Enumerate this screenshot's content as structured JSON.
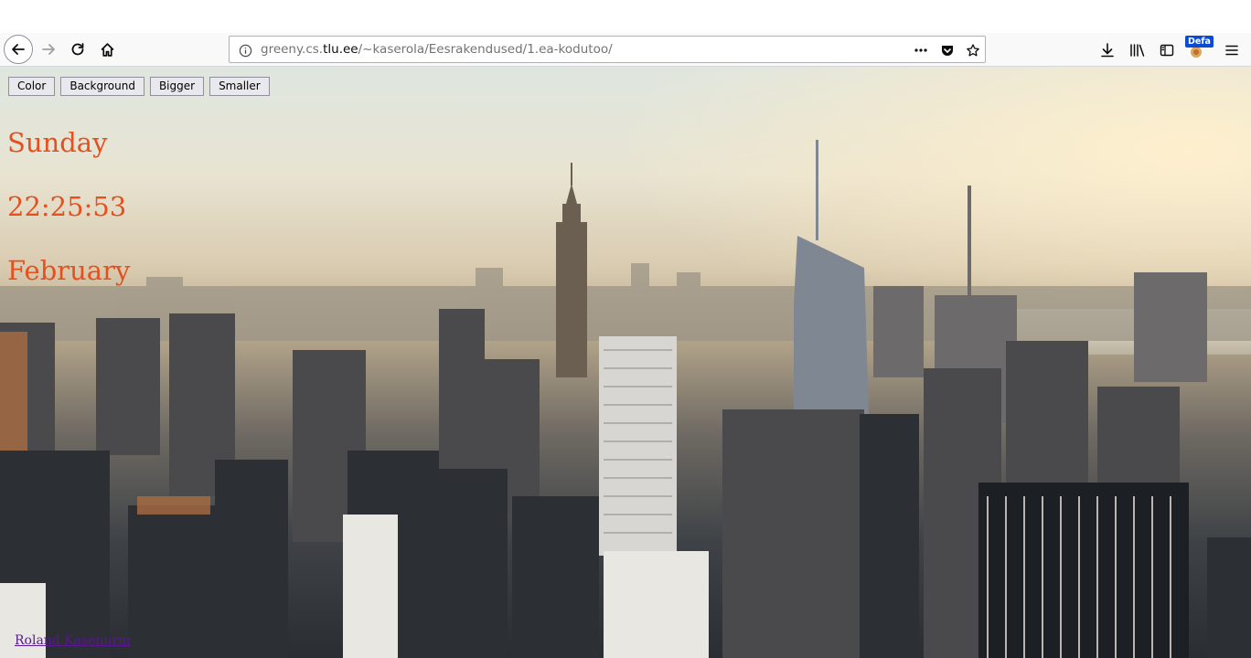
{
  "browser": {
    "url": {
      "prefix": "greeny.cs.",
      "domain": "tlu.ee",
      "path": "/~kaserola/Eesrakendused/1.ea-kodutoo/"
    },
    "badge_label": "Defa",
    "icons": {
      "back": "back-arrow-icon",
      "forward": "forward-arrow-icon",
      "reload": "reload-icon",
      "home": "home-icon",
      "info": "info-icon",
      "more": "page-actions-icon",
      "pocket": "pocket-icon",
      "bookmark": "star-icon",
      "downloads": "download-icon",
      "library": "library-icon",
      "sidebar": "sidebar-icon",
      "extension": "extension-icon",
      "menu": "hamburger-menu-icon"
    }
  },
  "page": {
    "buttons": {
      "color": "Color",
      "background": "Background",
      "bigger": "Bigger",
      "smaller": "Smaller"
    },
    "day": "Sunday",
    "time": "22:25:53",
    "month": "February",
    "author_link": "Roland Kasenurm",
    "text_color": "#e6501e"
  }
}
